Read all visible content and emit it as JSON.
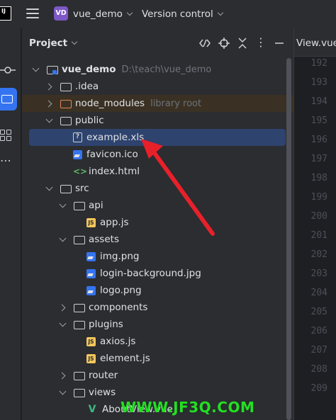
{
  "topbar": {
    "logo_text": "IJ",
    "project_badge": "VD",
    "project_badge_color": "#7d58c5",
    "project_name": "vue_demo",
    "vcs_label": "Version control"
  },
  "left_strip": {
    "icons": [
      "commit-icon",
      "project-folder-icon",
      "structure-icon",
      "more-icon"
    ]
  },
  "panel": {
    "title": "Project",
    "header_icons": [
      "code-icon",
      "locate-icon",
      "collapse-icon",
      "more-vertical-icon",
      "minimize-icon"
    ]
  },
  "tree": [
    {
      "name": "vue_demo",
      "hint": "D:\\teach\\vue_demo",
      "arrow": "down",
      "icon": "module",
      "depth": 0
    },
    {
      "name": ".idea",
      "hint": "",
      "arrow": "right",
      "icon": "folder",
      "depth": 1
    },
    {
      "name": "node_modules",
      "hint": "library root",
      "arrow": "right",
      "icon": "folder-orange",
      "depth": 1
    },
    {
      "name": "public",
      "hint": "",
      "arrow": "down",
      "icon": "folder",
      "depth": 1
    },
    {
      "name": "example.xls",
      "hint": "",
      "arrow": "none",
      "icon": "unknown-file",
      "depth": 2,
      "selected": true
    },
    {
      "name": "favicon.ico",
      "hint": "",
      "arrow": "none",
      "icon": "image",
      "depth": 2
    },
    {
      "name": "index.html",
      "hint": "",
      "arrow": "none",
      "icon": "html",
      "depth": 2
    },
    {
      "name": "src",
      "hint": "",
      "arrow": "down",
      "icon": "folder",
      "depth": 1
    },
    {
      "name": "api",
      "hint": "",
      "arrow": "down",
      "icon": "folder",
      "depth": 2
    },
    {
      "name": "app.js",
      "hint": "",
      "arrow": "none",
      "icon": "js",
      "depth": 3
    },
    {
      "name": "assets",
      "hint": "",
      "arrow": "down",
      "icon": "folder",
      "depth": 2
    },
    {
      "name": "img.png",
      "hint": "",
      "arrow": "none",
      "icon": "image",
      "depth": 3
    },
    {
      "name": "login-background.jpg",
      "hint": "",
      "arrow": "none",
      "icon": "image",
      "depth": 3
    },
    {
      "name": "logo.png",
      "hint": "",
      "arrow": "none",
      "icon": "image",
      "depth": 3
    },
    {
      "name": "components",
      "hint": "",
      "arrow": "right",
      "icon": "folder",
      "depth": 2
    },
    {
      "name": "plugins",
      "hint": "",
      "arrow": "down",
      "icon": "folder",
      "depth": 2
    },
    {
      "name": "axios.js",
      "hint": "",
      "arrow": "none",
      "icon": "js",
      "depth": 3
    },
    {
      "name": "element.js",
      "hint": "",
      "arrow": "none",
      "icon": "js",
      "depth": 3
    },
    {
      "name": "router",
      "hint": "",
      "arrow": "right",
      "icon": "folder",
      "depth": 2
    },
    {
      "name": "views",
      "hint": "",
      "arrow": "down",
      "icon": "folder",
      "depth": 2
    },
    {
      "name": "AboutView.vue",
      "hint": "",
      "arrow": "none",
      "icon": "vue",
      "depth": 3
    }
  ],
  "editor": {
    "tab_label": "View.vue",
    "line_numbers": [
      "192",
      "193",
      "194",
      "195",
      "196",
      "197",
      "198",
      "199",
      "200",
      "201",
      "202",
      "203",
      "204",
      "205",
      "206",
      "207",
      "208",
      "209"
    ]
  },
  "watermark": "WWW.JF3Q.COM"
}
